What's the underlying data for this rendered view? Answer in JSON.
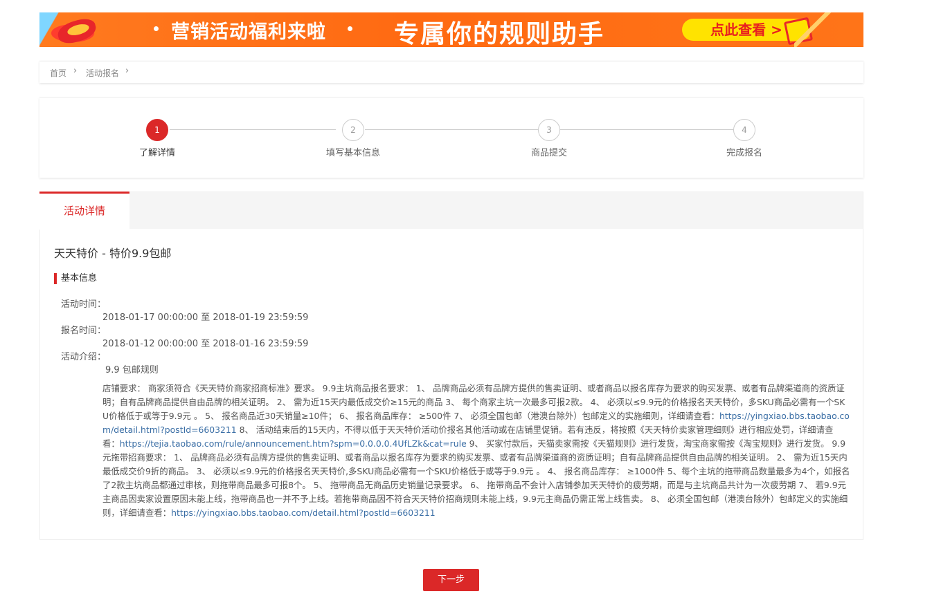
{
  "banner": {
    "text_left": "营销活动福利来啦",
    "text_main": "专属你的规则助手",
    "cta_label": "点此查看 >"
  },
  "breadcrumb": {
    "home": "首页",
    "current": "活动报名"
  },
  "steps": [
    {
      "number": "1",
      "label": "了解详情",
      "active": true
    },
    {
      "number": "2",
      "label": "填写基本信息",
      "active": false
    },
    {
      "number": "3",
      "label": "商品提交",
      "active": false
    },
    {
      "number": "4",
      "label": "完成报名",
      "active": false
    }
  ],
  "tab": {
    "label": "活动详情"
  },
  "activity": {
    "title": "天天特价 - 特价9.9包邮",
    "section_title": "基本信息",
    "activity_time_label": "活动时间：",
    "activity_time_value": "2018-01-17 00:00:00 至 2018-01-19 23:59:59",
    "signup_time_label": "报名时间：",
    "signup_time_value": "2018-01-12 00:00:00 至 2018-01-16 23:59:59",
    "intro_label": "活动介绍：",
    "intro_value": "9.9 包邮规则",
    "rules_part1": "店铺要求： 商家须符合《天天特价商家招商标准》要求。 9.9主坑商品报名要求： 1、 品牌商品必须有品牌方提供的售卖证明、或者商品以报名库存为要求的购买发票、或者有品牌渠道商的资质证明；自有品牌商品提供自由品牌的相关证明。 2、 需为近15天内最低成交价≥15元的商品 3、 每个商家主坑一次最多可报2款。 4、 必须以≤9.9元的价格报名天天特价，多SKU商品必需有一个SKU价格低于或等于9.9元 。 5、 报名商品近30天销量≥10件； 6、 报名商品库存： ≥500件 7、 必须全国包邮（港澳台除外）包邮定义的实施细则，详细请查看：",
    "rules_link1": "https://yingxiao.bbs.taobao.com/detail.html?postId=6603211",
    "rules_part2": " 8、 活动结束后的15天内，不得以低于天天特价活动价报名其他活动或在店铺里促销。若有违反，将按照《天天特价卖家管理细则》进行相应处罚，详细请查看：",
    "rules_link2": "https://tejia.taobao.com/rule/announcement.htm?spm=0.0.0.0.4UfLZk&cat=rule",
    "rules_part3": " 9、 买家付款后，天猫卖家需按《天猫规则》进行发货，淘宝商家需按《淘宝规则》进行发货。 9.9元拖带招商要求： 1、 品牌商品必须有品牌方提供的售卖证明、或者商品以报名库存为要求的购买发票、或者有品牌渠道商的资质证明；自有品牌商品提供自由品牌的相关证明。 2、 需为近15天内最低成交价9折的商品。 3、 必须以≤9.9元的价格报名天天特价,多SKU商品必需有一个SKU价格低于或等于9.9元 。 4、 报名商品库存： ≥1000件 5、每个主坑的拖带商品数量最多为4个，如报名了2款主坑商品都通过审核，则拖带商品最多可报8个。 5、 拖带商品无商品历史销量记录要求。 6、 拖带商品不会计入店铺参加天天特价的疲劳期，而是与主坑商品共计为一次疲劳期 7、 若9.9元主商品因卖家设置原因未能上线，拖带商品也一并不予上线。若拖带商品因不符合天天特价招商规则未能上线，9.9元主商品仍需正常上线售卖。 8、 必须全国包邮（港澳台除外）包邮定义的实施细则，详细请查看：",
    "rules_link3": "https://yingxiao.bbs.taobao.com/detail.html?postId=6603211"
  },
  "footer": {
    "next_label": "下一步"
  },
  "colors": {
    "accent": "#db2828",
    "banner": "#ff6a12",
    "cta": "#ffe300"
  }
}
